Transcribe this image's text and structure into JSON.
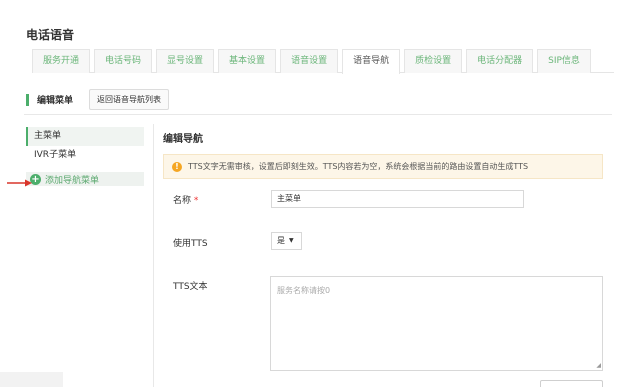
{
  "page": {
    "title": "电话语音"
  },
  "tabs": [
    {
      "label": "服务开通"
    },
    {
      "label": "电话号码"
    },
    {
      "label": "显号设置"
    },
    {
      "label": "基本设置"
    },
    {
      "label": "语音设置"
    },
    {
      "label": "语音导航"
    },
    {
      "label": "质检设置"
    },
    {
      "label": "电话分配器"
    },
    {
      "label": "SIP信息"
    }
  ],
  "active_tab_index": 5,
  "sub_header": {
    "title": "编辑菜单",
    "back_button": "返回语音导航列表"
  },
  "sidebar": {
    "items": [
      {
        "label": "主菜单"
      },
      {
        "label": "IVR子菜单"
      }
    ],
    "add_label": "添加导航菜单"
  },
  "editor": {
    "title": "编辑导航",
    "notice": "TTS文字无需审核，设置后即刻生效。TTS内容若为空，系统会根据当前的路由设置自动生成TTS",
    "name_label": "名称",
    "name_required": "*",
    "name_value": "主菜单",
    "tts_label": "使用TTS",
    "tts_value": "是",
    "tts_text_label": "TTS文本",
    "tts_text_placeholder": "服务名称请按0"
  },
  "colors": {
    "accent": "#4cae6b",
    "tab_text": "#6bb67a",
    "notice_bg": "#fdf6e8",
    "warning": "#f5a623",
    "arrow": "#d9362b"
  }
}
